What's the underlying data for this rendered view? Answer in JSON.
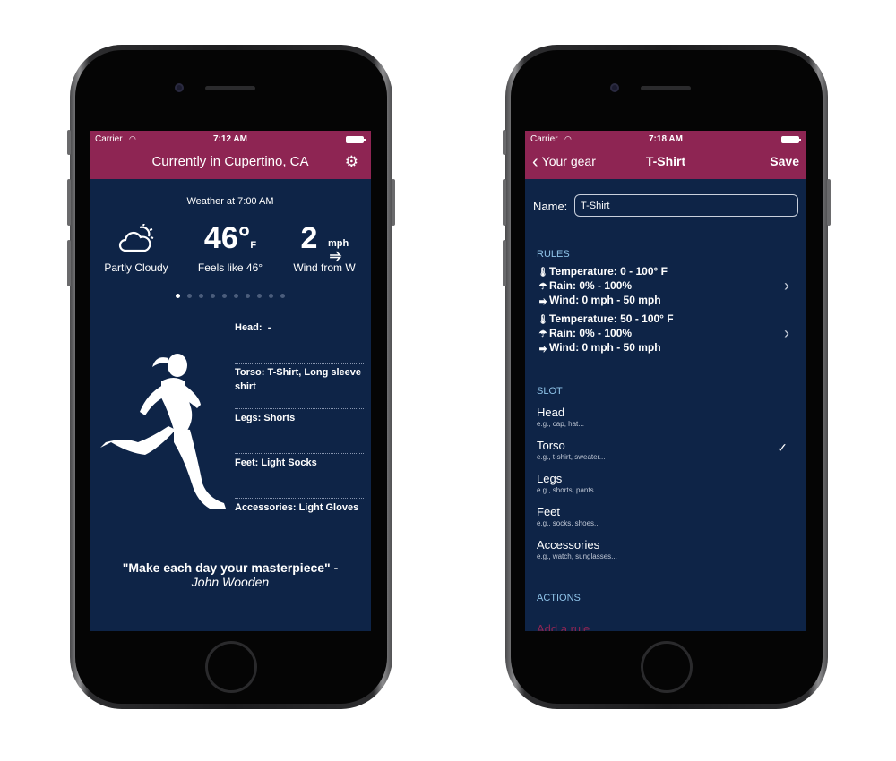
{
  "screen1": {
    "status": {
      "carrier": "Carrier",
      "time": "7:12 AM"
    },
    "nav_title": "Currently in Cupertino, CA",
    "weather_heading": "Weather at 7:00 AM",
    "condition": "Partly Cloudy",
    "temperature": "46°",
    "temp_unit": "F",
    "feels_like": "Feels like 46°",
    "wind_speed": "2",
    "wind_unit": "mph",
    "wind_direction": "Wind from W",
    "page_count": 10,
    "active_page": 1,
    "slots": [
      {
        "label": "Head:",
        "value": "-"
      },
      {
        "label": "Torso:",
        "value": "T-Shirt, Long sleeve shirt"
      },
      {
        "label": "Legs:",
        "value": "Shorts"
      },
      {
        "label": "Feet:",
        "value": "Light Socks"
      },
      {
        "label": "Accessories:",
        "value": "Light Gloves"
      }
    ],
    "quote": "\"Make each day your masterpiece\" -",
    "quote_author": "John Wooden"
  },
  "screen2": {
    "status": {
      "carrier": "Carrier",
      "time": "7:18 AM"
    },
    "back_label": "Your gear",
    "nav_title": "T-Shirt",
    "save_label": "Save",
    "name_label": "Name:",
    "name_value": "T-Shirt",
    "rules_header": "RULES",
    "rules": [
      {
        "temperature": "Temperature: 0 - 100° F",
        "rain": "Rain: 0% - 100%",
        "wind": "Wind: 0 mph - 50 mph"
      },
      {
        "temperature": "Temperature: 50 - 100° F",
        "rain": "Rain: 0% - 100%",
        "wind": "Wind: 0 mph - 50 mph"
      }
    ],
    "slot_header": "SLOT",
    "slots": [
      {
        "title": "Head",
        "subtitle": "e.g., cap, hat..."
      },
      {
        "title": "Torso",
        "subtitle": "e.g., t-shirt, sweater...",
        "selected": true
      },
      {
        "title": "Legs",
        "subtitle": "e.g., shorts, pants..."
      },
      {
        "title": "Feet",
        "subtitle": "e.g., socks, shoes..."
      },
      {
        "title": "Accessories",
        "subtitle": "e.g., watch, sunglasses..."
      }
    ],
    "actions_header": "ACTIONS",
    "add_rule_label": "Add a rule"
  },
  "colors": {
    "nav": "#8e2553",
    "background": "#0e2447",
    "section_header": "#8fc3e8"
  }
}
